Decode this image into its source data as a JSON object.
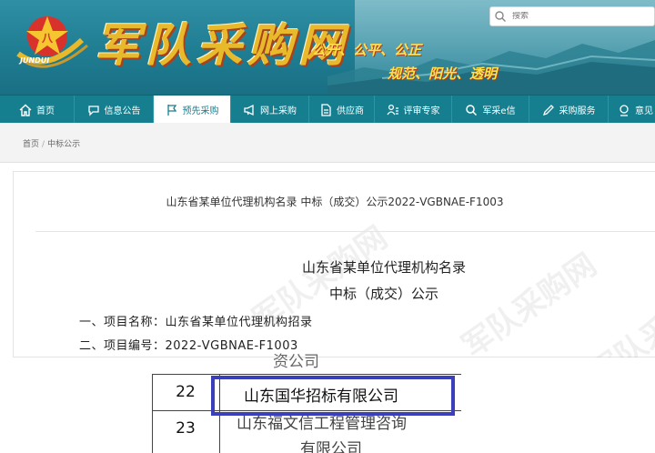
{
  "header": {
    "logo_text": "军队采购网",
    "logo_sub": "JUNDUI",
    "slogan_line1": "公开、公平、公正",
    "slogan_line2": "规范、阳光、透明",
    "search_placeholder": "搜索"
  },
  "nav": {
    "items": [
      {
        "label": "首页",
        "icon": "home-icon"
      },
      {
        "label": "信息公告",
        "icon": "chat-icon"
      },
      {
        "label": "预先采购",
        "icon": "flag-icon"
      },
      {
        "label": "网上采购",
        "icon": "megaphone-icon"
      },
      {
        "label": "供应商",
        "icon": "document-icon"
      },
      {
        "label": "评审专家",
        "icon": "person-list-icon"
      },
      {
        "label": "军采e信",
        "icon": "search-icon"
      },
      {
        "label": "采购服务",
        "icon": "pen-icon"
      },
      {
        "label": "意见",
        "icon": "feedback-icon"
      }
    ],
    "active_index": 2
  },
  "breadcrumb": {
    "home": "首页",
    "separator": "/",
    "current": "中标公示"
  },
  "notice": {
    "title": "山东省某单位代理机构名录 中标（成交）公示2022-VGBNAE-F1003",
    "heading1": "山东省某单位代理机构名录",
    "heading2": "中标（成交）公示",
    "line1": "一、项目名称：山东省某单位代理机构招录",
    "line2": "二、项目编号：2022-VGBNAE-F1003",
    "watermark": "军队采购网"
  },
  "table": {
    "rows": [
      {
        "num": "22",
        "name": "山东国华招标有限公司"
      },
      {
        "num": "23",
        "name": "山东福文信工程管理咨询"
      }
    ],
    "partial_top": "资公司",
    "partial_bottom": "有限公司"
  },
  "colors": {
    "nav_bg": "#167f8f",
    "highlight_border": "#3b3fb8",
    "logo_gold": "#e8b92a"
  }
}
